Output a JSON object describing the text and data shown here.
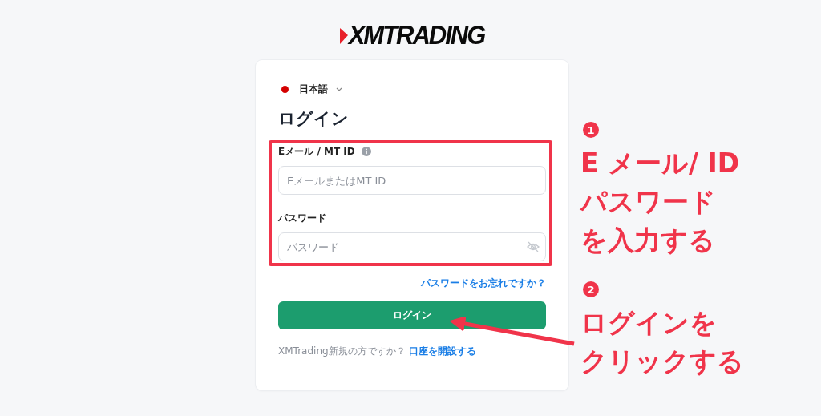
{
  "logo": {
    "text": "XMTRADING"
  },
  "language": {
    "label": "日本語",
    "color": "#d40000"
  },
  "title": "ログイン",
  "fields": [
    {
      "kind": "text",
      "label": "Eメール / MT ID",
      "info": true,
      "placeholder": "EメールまたはMT ID"
    },
    {
      "kind": "password",
      "label": "パスワード",
      "info": false,
      "placeholder": "パスワード"
    }
  ],
  "forgot_link": "パスワードをお忘れですか？",
  "login_button": "ログイン",
  "signup": {
    "prompt": "XMTrading新規の方ですか？",
    "link": "口座を開設する"
  },
  "annotations": [
    {
      "number": "1",
      "lines": [
        "E メール/ ID",
        "パスワード",
        "を入力する"
      ]
    },
    {
      "number": "2",
      "lines": [
        "ログインを",
        "クリックする"
      ]
    }
  ]
}
